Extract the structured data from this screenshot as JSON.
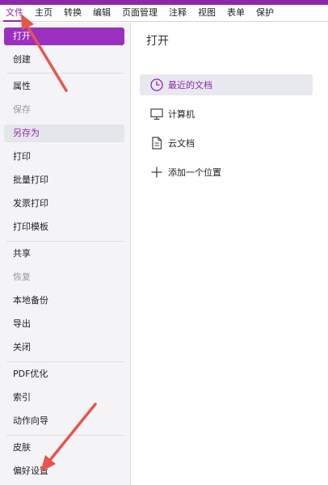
{
  "menubar": {
    "items": [
      {
        "label": "文件"
      },
      {
        "label": "主页"
      },
      {
        "label": "转换"
      },
      {
        "label": "编辑"
      },
      {
        "label": "页面管理"
      },
      {
        "label": "注释"
      },
      {
        "label": "视图"
      },
      {
        "label": "表单"
      },
      {
        "label": "保护"
      }
    ],
    "active": "文件"
  },
  "sidebar": {
    "items": [
      {
        "label": "打开",
        "state": "selected"
      },
      {
        "label": "创建",
        "state": "normal"
      },
      {
        "label": "属性",
        "state": "normal"
      },
      {
        "label": "保存",
        "state": "disabled"
      },
      {
        "label": "另存为",
        "state": "hovered"
      },
      {
        "label": "打印",
        "state": "normal"
      },
      {
        "label": "批量打印",
        "state": "normal"
      },
      {
        "label": "发票打印",
        "state": "normal"
      },
      {
        "label": "打印模板",
        "state": "normal"
      },
      {
        "label": "共享",
        "state": "normal"
      },
      {
        "label": "恢复",
        "state": "disabled"
      },
      {
        "label": "本地备份",
        "state": "normal"
      },
      {
        "label": "导出",
        "state": "normal"
      },
      {
        "label": "关闭",
        "state": "normal"
      },
      {
        "label": "PDF优化",
        "state": "normal"
      },
      {
        "label": "索引",
        "state": "normal"
      },
      {
        "label": "动作向导",
        "state": "normal"
      },
      {
        "label": "皮肤",
        "state": "normal"
      },
      {
        "label": "偏好设置",
        "state": "normal"
      }
    ]
  },
  "panel": {
    "title": "打开",
    "options": [
      {
        "label": "最近的文档",
        "icon": "clock-icon",
        "state": "selected"
      },
      {
        "label": "计算机",
        "icon": "monitor-icon",
        "state": "normal"
      },
      {
        "label": "云文档",
        "icon": "document-icon",
        "state": "normal"
      },
      {
        "label": "添加一个位置",
        "icon": "plus-icon",
        "state": "normal"
      }
    ]
  },
  "colors": {
    "accent": "#8a2aa8",
    "selected_bg": "#9b30c0",
    "annotation_arrow": "#e8544e",
    "sidebar_bg": "#f4f4f7"
  }
}
